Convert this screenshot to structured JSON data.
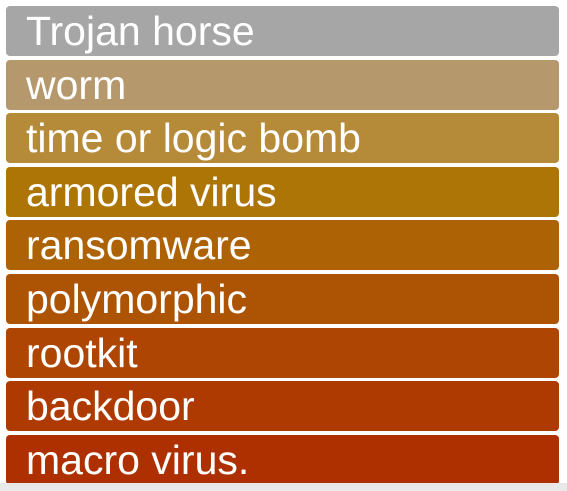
{
  "items": [
    {
      "label": "Trojan horse",
      "color": "#a6a6a6"
    },
    {
      "label": "worm",
      "color": "#b5986b"
    },
    {
      "label": "time or logic bomb",
      "color": "#b58a39"
    },
    {
      "label": "armored virus",
      "color": "#ad7406"
    },
    {
      "label": "ransomware",
      "color": "#ad6305"
    },
    {
      "label": "polymorphic",
      "color": "#ad5304"
    },
    {
      "label": "rootkit",
      "color": "#ae4503"
    },
    {
      "label": "backdoor",
      "color": "#ae3a02"
    },
    {
      "label": "macro virus.",
      "color": "#ae3001"
    }
  ]
}
